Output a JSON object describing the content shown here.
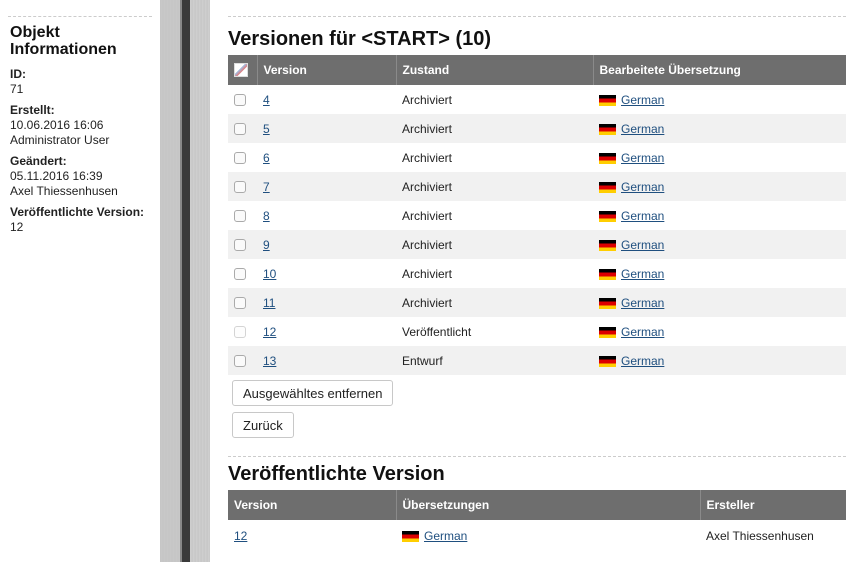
{
  "info": {
    "title": "Objekt Informationen",
    "id_label": "ID:",
    "id_value": "71",
    "created_label": "Erstellt:",
    "created_date": "10.06.2016 16:06",
    "created_user": "Administrator User",
    "changed_label": "Geändert:",
    "changed_date": "05.11.2016 16:39",
    "changed_user": "Axel Thiessenhusen",
    "published_label": "Veröffentlichte Version:",
    "published_value": "12"
  },
  "versions": {
    "heading": "Versionen für <START> (10)",
    "columns": [
      "Version",
      "Zustand",
      "Bearbeitete Übersetzung"
    ],
    "rows": [
      {
        "version": "4",
        "status": "Archiviert",
        "translation": "German"
      },
      {
        "version": "5",
        "status": "Archiviert",
        "translation": "German"
      },
      {
        "version": "6",
        "status": "Archiviert",
        "translation": "German"
      },
      {
        "version": "7",
        "status": "Archiviert",
        "translation": "German"
      },
      {
        "version": "8",
        "status": "Archiviert",
        "translation": "German"
      },
      {
        "version": "9",
        "status": "Archiviert",
        "translation": "German"
      },
      {
        "version": "10",
        "status": "Archiviert",
        "translation": "German"
      },
      {
        "version": "11",
        "status": "Archiviert",
        "translation": "German"
      },
      {
        "version": "12",
        "status": "Veröffentlicht",
        "translation": "German"
      },
      {
        "version": "13",
        "status": "Entwurf",
        "translation": "German"
      }
    ],
    "remove_button": "Ausgewähltes entfernen",
    "back_button": "Zurück"
  },
  "published": {
    "heading": "Veröffentlichte Version",
    "columns": [
      "Version",
      "Übersetzungen",
      "Ersteller"
    ],
    "row": {
      "version": "12",
      "translation": "German",
      "author": "Axel Thiessenhusen"
    }
  },
  "icons": {
    "flag": "german-flag-icon",
    "select_all": "select-all-checkbox-icon"
  },
  "colors": {
    "table_header": "#6e6e6e",
    "link": "#1f4f7f",
    "row_alt": "#f1f1f1"
  }
}
